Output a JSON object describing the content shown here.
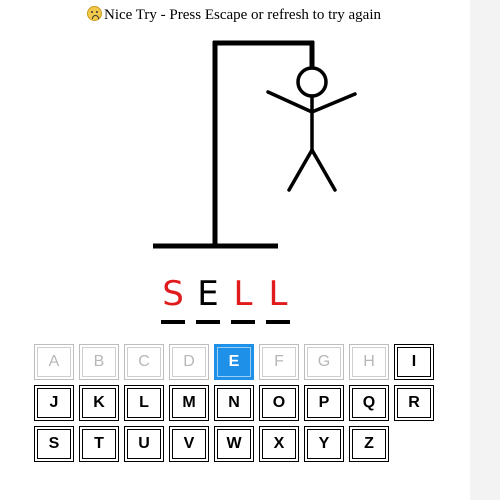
{
  "status": {
    "emoji": "crying-face",
    "text": "Nice Try - Press Escape or refresh to try again"
  },
  "word": [
    {
      "letter": "S",
      "color": "#e01b1b"
    },
    {
      "letter": "E",
      "color": "#000000"
    },
    {
      "letter": "L",
      "color": "#e01b1b"
    },
    {
      "letter": "L",
      "color": "#e01b1b"
    }
  ],
  "keyboard": {
    "keys": [
      {
        "label": "A",
        "state": "used"
      },
      {
        "label": "B",
        "state": "used"
      },
      {
        "label": "C",
        "state": "used"
      },
      {
        "label": "D",
        "state": "used"
      },
      {
        "label": "E",
        "state": "active"
      },
      {
        "label": "F",
        "state": "used"
      },
      {
        "label": "G",
        "state": "used"
      },
      {
        "label": "H",
        "state": "used"
      },
      {
        "label": "I",
        "state": "available"
      },
      {
        "label": "J",
        "state": "available"
      },
      {
        "label": "K",
        "state": "available"
      },
      {
        "label": "L",
        "state": "available"
      },
      {
        "label": "M",
        "state": "available"
      },
      {
        "label": "N",
        "state": "available"
      },
      {
        "label": "O",
        "state": "available"
      },
      {
        "label": "P",
        "state": "available"
      },
      {
        "label": "Q",
        "state": "available"
      },
      {
        "label": "R",
        "state": "available"
      },
      {
        "label": "S",
        "state": "available"
      },
      {
        "label": "T",
        "state": "available"
      },
      {
        "label": "U",
        "state": "available"
      },
      {
        "label": "V",
        "state": "available"
      },
      {
        "label": "W",
        "state": "available"
      },
      {
        "label": "X",
        "state": "available"
      },
      {
        "label": "Y",
        "state": "available"
      },
      {
        "label": "Z",
        "state": "available"
      }
    ]
  },
  "colors": {
    "wrong_letter": "#e01b1b",
    "active_key": "#1e90e8",
    "used_key_text": "#b7b7b7"
  }
}
